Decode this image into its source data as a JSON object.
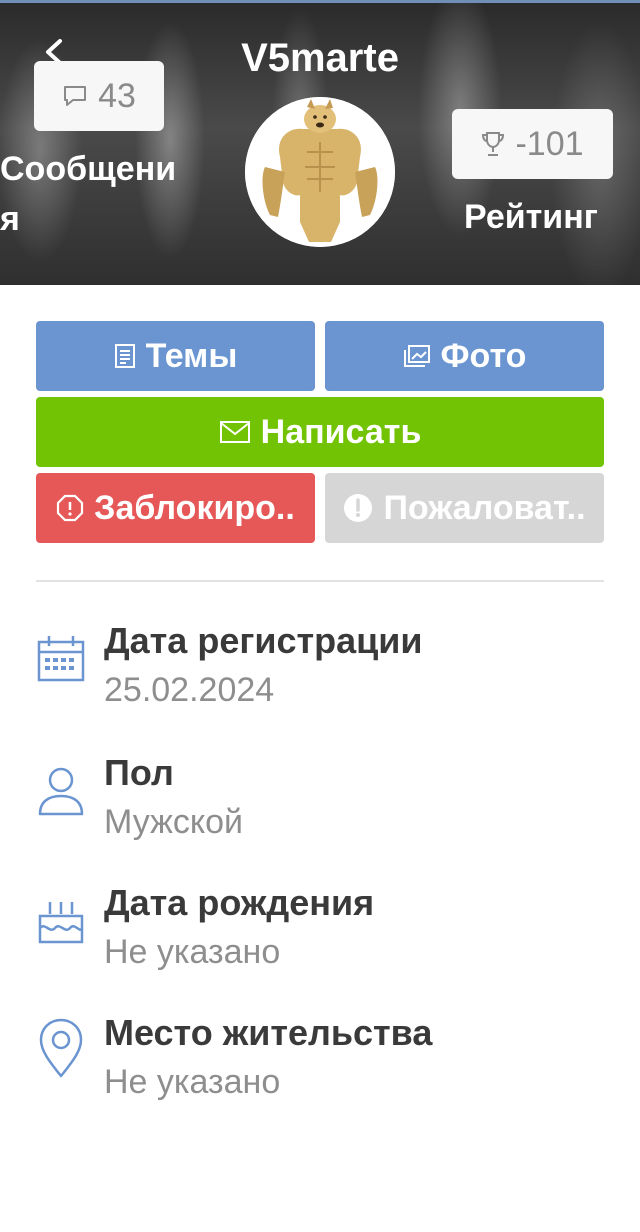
{
  "profile": {
    "username": "V5marte",
    "messages_count": "43",
    "messages_label": "Сообщения",
    "rating_value": "-101",
    "rating_label": "Рейтинг"
  },
  "icons": {
    "back": "chevron-left-icon",
    "messages": "speech-bubble-icon",
    "rating": "trophy-icon",
    "topics": "document-icon",
    "photo": "image-icon",
    "write": "envelope-icon",
    "block": "octagon-alert-icon",
    "report": "exclamation-circle-icon",
    "registration": "calendar-icon",
    "gender": "person-icon",
    "birthday": "cake-icon",
    "location": "map-pin-icon"
  },
  "actions": {
    "topics": "Темы",
    "photo": "Фото",
    "write": "Написать",
    "block": "Заблокиро..",
    "report": "Пожаловат.."
  },
  "colors": {
    "primary_button": "#6b95d0",
    "write_button": "#72c303",
    "block_button": "#e65757",
    "report_button": "#d6d6d6",
    "icon_accent": "#6b95d0"
  },
  "info": [
    {
      "label": "Дата регистрации",
      "value": "25.02.2024"
    },
    {
      "label": "Пол",
      "value": "Мужской"
    },
    {
      "label": "Дата рождения",
      "value": "Не указано"
    },
    {
      "label": "Место жительства",
      "value": "Не указано"
    }
  ]
}
